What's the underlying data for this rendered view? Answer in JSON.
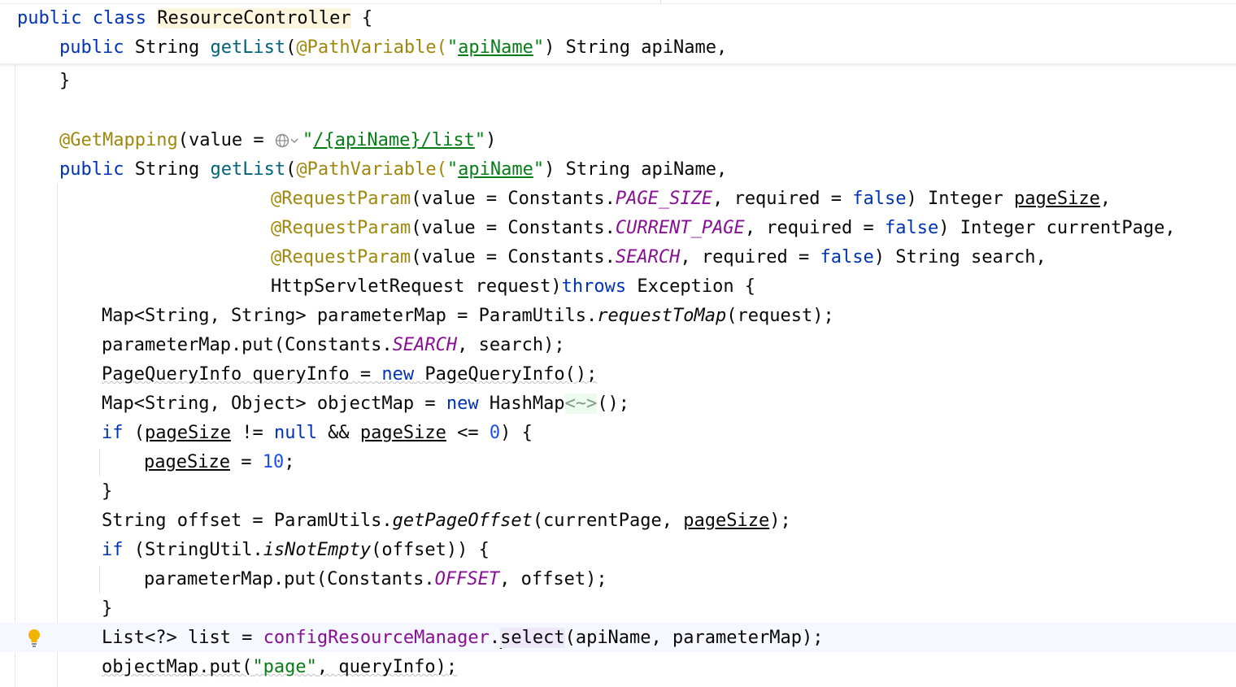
{
  "sticky": {
    "line1": [
      "public",
      " ",
      "class",
      " ",
      "ResourceController",
      " {"
    ],
    "line2": [
      "public",
      " String ",
      "getList",
      "(",
      "@PathVariable",
      "(\"",
      "apiName",
      "\")",
      " String apiName,"
    ]
  },
  "code": {
    "l1": "}",
    "l3": [
      "@GetMapping",
      "(value = ",
      "\"",
      "/{apiName}/list",
      "\")"
    ],
    "l4": [
      "public",
      " String ",
      "getList",
      "(",
      "@PathVariable",
      "(\"",
      "apiName",
      "\")",
      " String apiName,"
    ],
    "l5": [
      "@RequestParam",
      "(value = Constants.",
      "PAGE_SIZE",
      ", required = ",
      "false",
      ") Integer ",
      "pageSize",
      ","
    ],
    "l6": [
      "@RequestParam",
      "(value = Constants.",
      "CURRENT_PAGE",
      ", required = ",
      "false",
      ") Integer currentPage,"
    ],
    "l7": [
      "@RequestParam",
      "(value = Constants.",
      "SEARCH",
      ", required = ",
      "false",
      ") String search,"
    ],
    "l8": [
      "HttpServletRequest request)",
      "throws",
      " Exception {"
    ],
    "l9": [
      "Map<String, String> parameterMap = ParamUtils.",
      "requestToMap",
      "(request);"
    ],
    "l10": [
      "parameterMap.put(Constants.",
      "SEARCH",
      ", search);"
    ],
    "l11": [
      "PageQueryInfo queryInfo",
      " = ",
      "new",
      " PageQueryInfo();"
    ],
    "l12": [
      "Map<String, Object> objectMap = ",
      "new",
      " HashMap",
      "<~>",
      "();"
    ],
    "l13": [
      "if",
      " (",
      "pageSize",
      " != ",
      "null",
      " && ",
      "pageSize",
      " <= ",
      "0",
      ") {"
    ],
    "l14": [
      "pageSize",
      " = ",
      "10",
      ";"
    ],
    "l15": "}",
    "l16": [
      "String offset = ParamUtils.",
      "getPageOffset",
      "(currentPage, ",
      "pageSize",
      ");"
    ],
    "l17": [
      "if",
      " (StringUtil.",
      "isNotEmpty",
      "(offset)) {"
    ],
    "l18": [
      "parameterMap.put(Constants.",
      "OFFSET",
      ", offset);"
    ],
    "l19": "}",
    "l20": [
      "List<?> list = ",
      "configResourceManager",
      ".",
      "select",
      "(apiName, parameterMap);"
    ],
    "l21": [
      "objectMap.put(",
      "\"page\"",
      ", queryInfo);"
    ]
  },
  "icons": {
    "inlay": "globe-icon",
    "intention": "lightbulb-icon"
  },
  "colors": {
    "keyword": "#0033b3",
    "annotation": "#9e880d",
    "string": "#067d17",
    "function": "#00627a",
    "constant": "#871094",
    "number": "#1750eb",
    "caret_line": "#f5f8fe"
  }
}
